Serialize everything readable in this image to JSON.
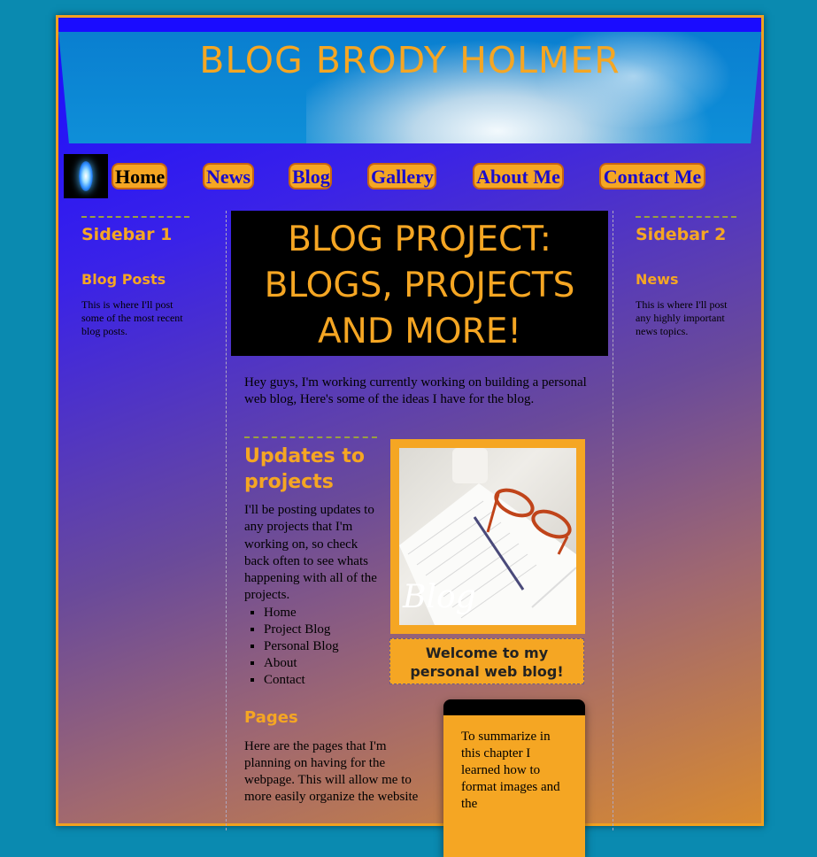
{
  "header": {
    "site_title": "BLOG BRODY HOLMER"
  },
  "nav": {
    "items": [
      {
        "label": "Home"
      },
      {
        "label": "News"
      },
      {
        "label": "Blog"
      },
      {
        "label": "Gallery"
      },
      {
        "label": "About Me"
      },
      {
        "label": "Contact Me"
      }
    ]
  },
  "sidebar1": {
    "title": "Sidebar 1",
    "subtitle": "Blog Posts",
    "text": "This is where I'll post some of the most recent blog posts."
  },
  "sidebar2": {
    "title": "Sidebar 2",
    "subtitle": "News",
    "text": "This is where I'll post any highly important news topics."
  },
  "main": {
    "headline": "BLOG PROJECT: BLOGS, PROJECTS AND MORE!",
    "intro": "Hey guys, I'm working currently working on building a personal web blog, Here's some of the ideas I have for the blog.",
    "updates_title": "Updates to projects",
    "updates_text": "I'll be posting updates to any projects that I'm working on, so check back often to see whats happening with all of the projects.",
    "list": [
      "Home",
      "Project Blog",
      "Personal Blog",
      "About",
      "Contact"
    ],
    "image_text": "Blog",
    "caption": "Welcome to my personal web blog!",
    "pages_title": "Pages",
    "pages_text": "Here are the pages that I'm planning on having for the webpage. This will allow me to more easily organize the website",
    "summary_text": "To summarize in this chapter I learned how to format images and the"
  },
  "colors": {
    "accent": "#f5a623",
    "background": "#0a8ab0",
    "nav_text": "#1a0ccc"
  }
}
